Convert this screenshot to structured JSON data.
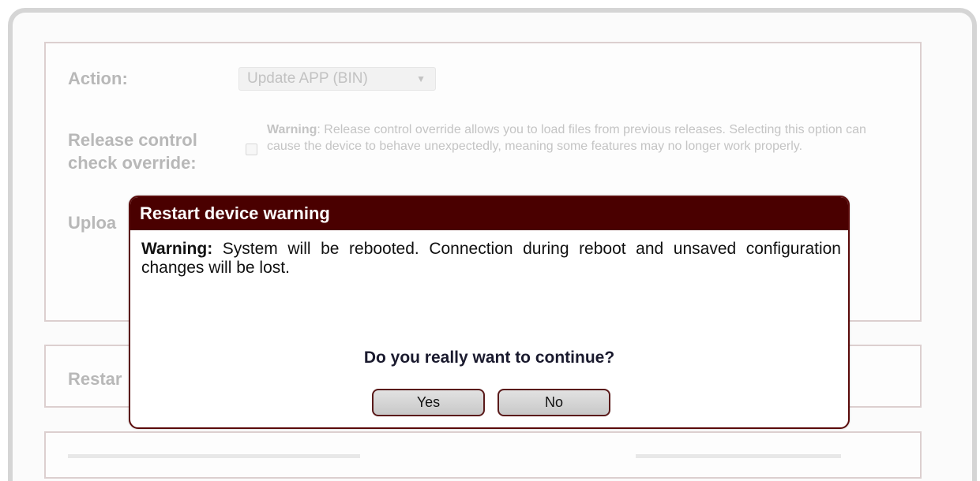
{
  "form": {
    "action_label": "Action:",
    "action_select_value": "Update APP (BIN)",
    "release_label_line1": "Release control",
    "release_label_line2": "check override:",
    "override_warning_bold": "Warning",
    "override_warning_text": ": Release control override allows you to load files from previous releases. Selecting this option can cause the device to behave unexpectedly, meaning some features may no longer work properly.",
    "upload_label_partial": "Uploa",
    "restart_label_partial": "Restar"
  },
  "modal": {
    "title": "Restart device warning",
    "message_bold": "Warning:",
    "message_text": " System will be rebooted. Connection during reboot and unsaved configuration changes will be lost.",
    "question": "Do you really want to continue?",
    "yes_label": "Yes",
    "no_label": "No"
  },
  "colors": {
    "modal_header": "#4a0000",
    "modal_border": "#5a0a0a"
  }
}
